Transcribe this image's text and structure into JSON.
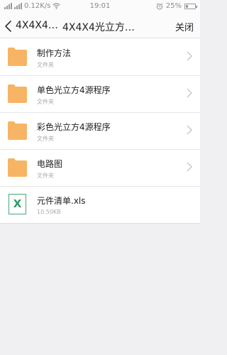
{
  "status_bar": {
    "network_speed": "0.12K/s",
    "time": "19:01",
    "battery_percent": "25%",
    "battery_level": 0.25
  },
  "nav": {
    "path": "4X4X4…",
    "title": "4X4X4光立方…",
    "close_label": "关闭"
  },
  "items": [
    {
      "name": "制作方法",
      "meta": "文件夹",
      "icon": "folder-icon",
      "has_chevron": true
    },
    {
      "name": "单色光立方4源程序",
      "meta": "文件夹",
      "icon": "folder-icon",
      "has_chevron": true
    },
    {
      "name": "彩色光立方4源程序",
      "meta": "文件夹",
      "icon": "folder-icon",
      "has_chevron": true
    },
    {
      "name": "电路图",
      "meta": "文件夹",
      "icon": "folder-icon",
      "has_chevron": true
    },
    {
      "name": "元件清单.xls",
      "meta": "10.50KB",
      "icon": "excel-file-icon",
      "icon_letter": "X",
      "has_chevron": false
    }
  ],
  "colors": {
    "folder": "#f7b464",
    "excel": "#2e9a66",
    "background": "#f0f0f2"
  }
}
